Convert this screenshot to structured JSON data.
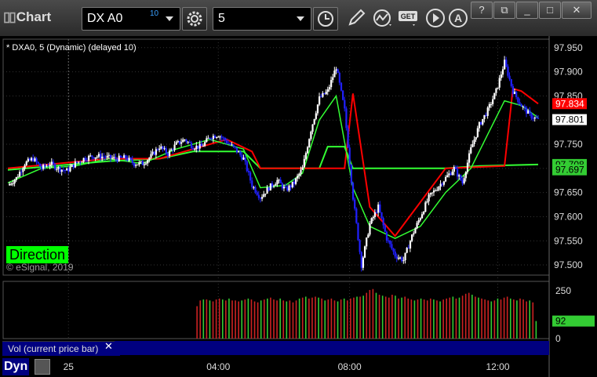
{
  "window": {
    "title": "Chart",
    "minimize_label": "_",
    "maximize_label": "□",
    "close_label": "✕",
    "help_label": "?"
  },
  "toolbar": {
    "symbol": "DX A0",
    "delay_badge": "10",
    "interval": "5",
    "icons": [
      "settings-gear-icon",
      "clock-icon",
      "pencil-icon",
      "study-wave-icon",
      "get-icon",
      "play-icon",
      "alert-icon"
    ]
  },
  "chart": {
    "study_title": "* DXA0, 5 (Dynamic) (delayed 10)",
    "direction_label": "Direction",
    "copyright": "© eSignal, 2019",
    "price_axis": [
      "97.950",
      "97.900",
      "97.850",
      "97.800",
      "97.750",
      "97.700",
      "97.650",
      "97.600",
      "97.550",
      "97.500"
    ],
    "price_tags": [
      {
        "label": "97.834",
        "color": "#ff0000",
        "text_color": "#ffffff"
      },
      {
        "label": "97.801",
        "color": "#ffffff",
        "text_color": "#000000"
      },
      {
        "label": "97.708",
        "color": "#33cc33",
        "text_color": "#000000"
      },
      {
        "label": "97.697",
        "color": "#33cc33",
        "text_color": "#000000"
      }
    ],
    "time_axis": [
      "25",
      "04:00",
      "08:00",
      "12:00"
    ],
    "colors": {
      "bull": "#ffffff",
      "bear": "#2020ff",
      "ma_fast": "#33ff33",
      "ma_red": "#ff0000",
      "direction_green": "#00ff00"
    }
  },
  "volume": {
    "label": "Vol (current price bar)",
    "close_label": "✕",
    "axis": [
      "250",
      "0"
    ],
    "current_tag": "92",
    "tag_color": "#33cc33"
  },
  "status": {
    "mode_label": "Dyn"
  },
  "chart_data": {
    "type": "candlestick",
    "title": "DXA0, 5 (Dynamic) (delayed 10)",
    "ylim": [
      97.48,
      97.96
    ],
    "y_ticks": [
      97.95,
      97.9,
      97.85,
      97.8,
      97.75,
      97.7,
      97.65,
      97.6,
      97.55,
      97.5
    ],
    "x_ticks": [
      "25",
      "04:00",
      "08:00",
      "12:00"
    ],
    "close_path": [
      [
        0,
        97.665
      ],
      [
        5,
        97.68
      ],
      [
        10,
        97.71
      ],
      [
        15,
        97.72
      ],
      [
        20,
        97.7
      ],
      [
        25,
        97.71
      ],
      [
        30,
        97.7
      ],
      [
        35,
        97.695
      ],
      [
        40,
        97.71
      ],
      [
        45,
        97.72
      ],
      [
        50,
        97.725
      ],
      [
        55,
        97.725
      ],
      [
        60,
        97.722
      ],
      [
        65,
        97.72
      ],
      [
        70,
        97.722
      ],
      [
        75,
        97.71
      ],
      [
        80,
        97.71
      ],
      [
        85,
        97.725
      ],
      [
        90,
        97.745
      ],
      [
        95,
        97.73
      ],
      [
        100,
        97.75
      ],
      [
        105,
        97.76
      ],
      [
        110,
        97.745
      ],
      [
        115,
        97.745
      ],
      [
        120,
        97.765
      ],
      [
        125,
        97.77
      ],
      [
        130,
        97.755
      ],
      [
        135,
        97.74
      ],
      [
        140,
        97.72
      ],
      [
        145,
        97.665
      ],
      [
        150,
        97.64
      ],
      [
        155,
        97.66
      ],
      [
        160,
        97.675
      ],
      [
        165,
        97.655
      ],
      [
        170,
        97.67
      ],
      [
        175,
        97.7
      ],
      [
        180,
        97.78
      ],
      [
        185,
        97.845
      ],
      [
        190,
        97.86
      ],
      [
        195,
        97.91
      ],
      [
        200,
        97.82
      ],
      [
        205,
        97.64
      ],
      [
        210,
        97.5
      ],
      [
        215,
        97.585
      ],
      [
        220,
        97.62
      ],
      [
        225,
        97.555
      ],
      [
        230,
        97.52
      ],
      [
        235,
        97.51
      ],
      [
        240,
        97.56
      ],
      [
        245,
        97.6
      ],
      [
        250,
        97.64
      ],
      [
        255,
        97.66
      ],
      [
        260,
        97.68
      ],
      [
        265,
        97.7
      ],
      [
        270,
        97.67
      ],
      [
        275,
        97.74
      ],
      [
        280,
        97.79
      ],
      [
        285,
        97.82
      ],
      [
        290,
        97.86
      ],
      [
        295,
        97.92
      ],
      [
        300,
        97.86
      ],
      [
        305,
        97.83
      ],
      [
        310,
        97.81
      ],
      [
        315,
        97.8
      ]
    ],
    "ma_green_fast": [
      [
        0,
        97.67
      ],
      [
        20,
        97.7
      ],
      [
        40,
        97.705
      ],
      [
        60,
        97.72
      ],
      [
        80,
        97.71
      ],
      [
        100,
        97.74
      ],
      [
        120,
        97.76
      ],
      [
        140,
        97.74
      ],
      [
        150,
        97.66
      ],
      [
        165,
        97.665
      ],
      [
        175,
        97.69
      ],
      [
        185,
        97.8
      ],
      [
        195,
        97.85
      ],
      [
        205,
        97.66
      ],
      [
        215,
        97.58
      ],
      [
        230,
        97.555
      ],
      [
        245,
        97.58
      ],
      [
        260,
        97.65
      ],
      [
        275,
        97.7
      ],
      [
        285,
        97.77
      ],
      [
        295,
        97.84
      ],
      [
        305,
        97.83
      ],
      [
        315,
        97.805
      ]
    ],
    "ma_green_slow": [
      [
        0,
        97.697
      ],
      [
        60,
        97.715
      ],
      [
        90,
        97.72
      ],
      [
        110,
        97.735
      ],
      [
        140,
        97.735
      ],
      [
        150,
        97.7
      ],
      [
        185,
        97.7
      ],
      [
        190,
        97.745
      ],
      [
        200,
        97.745
      ],
      [
        205,
        97.7
      ],
      [
        260,
        97.7
      ],
      [
        280,
        97.705
      ],
      [
        315,
        97.708
      ]
    ],
    "ma_red": [
      [
        0,
        97.7
      ],
      [
        60,
        97.72
      ],
      [
        90,
        97.72
      ],
      [
        115,
        97.745
      ],
      [
        130,
        97.76
      ],
      [
        145,
        97.735
      ],
      [
        150,
        97.7
      ],
      [
        200,
        97.7
      ],
      [
        205,
        97.855
      ],
      [
        215,
        97.62
      ],
      [
        230,
        97.56
      ],
      [
        260,
        97.7
      ],
      [
        295,
        97.705
      ],
      [
        300,
        97.865
      ],
      [
        305,
        97.86
      ],
      [
        315,
        97.834
      ]
    ],
    "volume": {
      "ylim": [
        0,
        300
      ],
      "start_index": 112,
      "values": [
        170,
        200,
        205,
        205,
        200,
        195,
        205,
        210,
        205,
        200,
        210,
        200,
        200,
        195,
        200,
        205,
        210,
        205,
        195,
        190,
        200,
        205,
        210,
        215,
        205,
        200,
        210,
        200,
        195,
        200,
        190,
        200,
        210,
        215,
        220,
        210,
        215,
        220,
        215,
        210,
        200,
        205,
        210,
        200,
        195,
        205,
        210,
        200,
        210,
        215,
        220,
        220,
        225,
        240,
        255,
        260,
        240,
        230,
        225,
        220,
        215,
        230,
        225,
        210,
        215,
        220,
        210,
        205,
        200,
        205,
        210,
        205,
        200,
        210,
        205,
        200,
        195,
        205,
        210,
        215,
        220,
        210,
        215,
        225,
        235,
        240,
        230,
        220,
        215,
        210,
        205,
        200,
        195,
        200,
        210,
        205,
        215,
        220,
        210,
        205,
        200,
        210,
        205,
        195,
        200,
        190,
        92
      ]
    }
  }
}
